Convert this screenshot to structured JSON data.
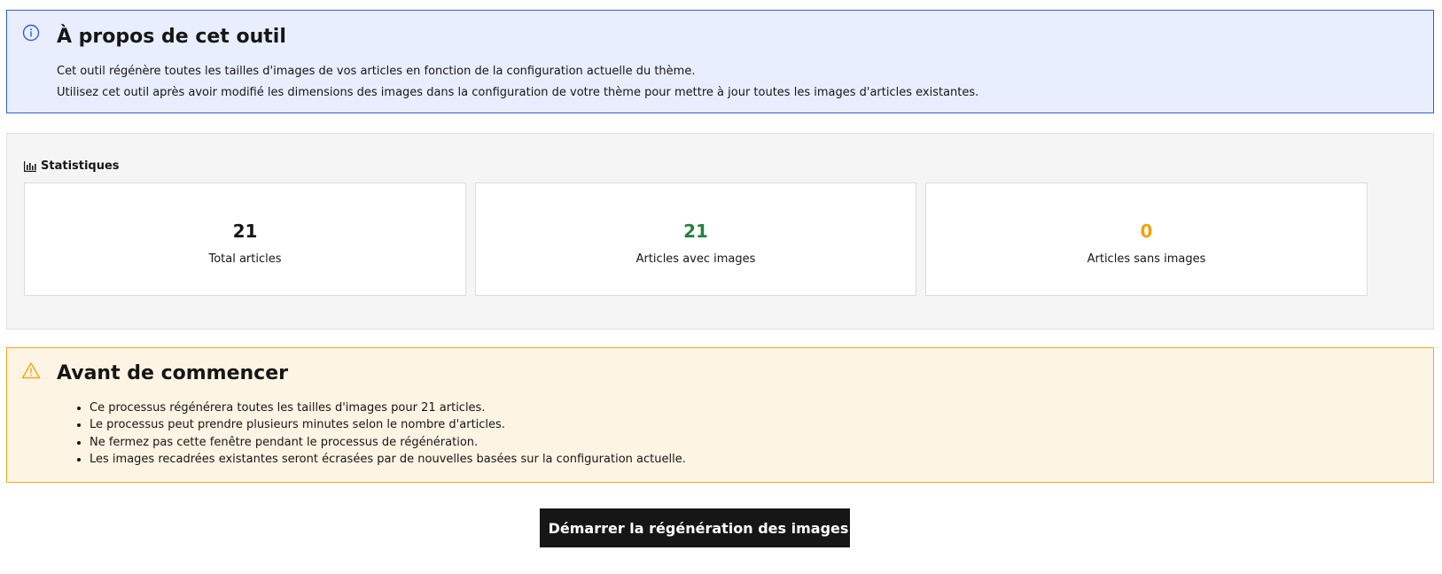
{
  "info": {
    "icon": "info-icon",
    "title": "À propos de cet outil",
    "lines": [
      "Cet outil régénère toutes les tailles d'images de vos articles en fonction de la configuration actuelle du thème.",
      "Utilisez cet outil après avoir modifié les dimensions des images dans la configuration de votre thème pour mettre à jour toutes les images d'articles existantes."
    ]
  },
  "stats": {
    "icon": "bar-chart-icon",
    "heading": "Statistiques",
    "cards": [
      {
        "value": "21",
        "label": "Total articles",
        "color": "#161616"
      },
      {
        "value": "21",
        "label": "Articles avec images",
        "color": "#24813f"
      },
      {
        "value": "0",
        "label": "Articles sans images",
        "color": "#f1a20f"
      }
    ]
  },
  "warning": {
    "icon": "warning-icon",
    "title": "Avant de commencer",
    "items": [
      "Ce processus régénérera toutes les tailles d'images pour 21 articles.",
      "Le processus peut prendre plusieurs minutes selon le nombre d'articles.",
      "Ne fermez pas cette fenêtre pendant le processus de régénération.",
      "Les images recadrées existantes seront écrasées par de nouvelles basées sur la configuration actuelle."
    ]
  },
  "action": {
    "icon": "refresh-icon",
    "label": "Démarrer la régénération des images"
  },
  "colors": {
    "info_bg": "#e8eefe",
    "info_border": "#2f5fd8",
    "warn_bg": "#fef4e4",
    "warn_border": "#f1a91b",
    "button_bg": "#161616"
  }
}
